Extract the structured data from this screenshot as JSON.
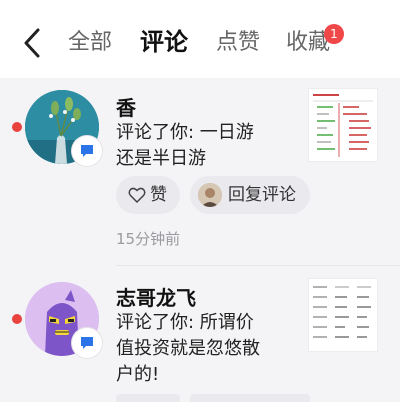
{
  "header": {
    "tabs": [
      {
        "label": "全部"
      },
      {
        "label": "评论"
      },
      {
        "label": "点赞"
      },
      {
        "label": "收藏"
      }
    ],
    "active_tab": "评论",
    "badge_count": "1"
  },
  "notifications": [
    {
      "user_name": "香",
      "comment_lines": [
        "评论了你: 一日游",
        "还是半日游"
      ],
      "like_label": "赞",
      "reply_label": "回复评论",
      "time": "15分钟前",
      "avatar": "plant-in-vase-photo",
      "thumbnail": "stock-table-screenshot"
    },
    {
      "user_name": "志哥龙飞",
      "comment_lines": [
        "评论了你: 所谓价",
        "值投资就是忽悠散",
        "户的!"
      ],
      "avatar": "purple-cartoon-character",
      "thumbnail": "financial-data-table-screenshot"
    }
  ],
  "colors": {
    "unread_dot": "#e8433f",
    "badge": "#f04848",
    "comment_icon": "#2a74e8",
    "avatar2_bg": "#d8b8ec",
    "character": "#7d55c8"
  }
}
